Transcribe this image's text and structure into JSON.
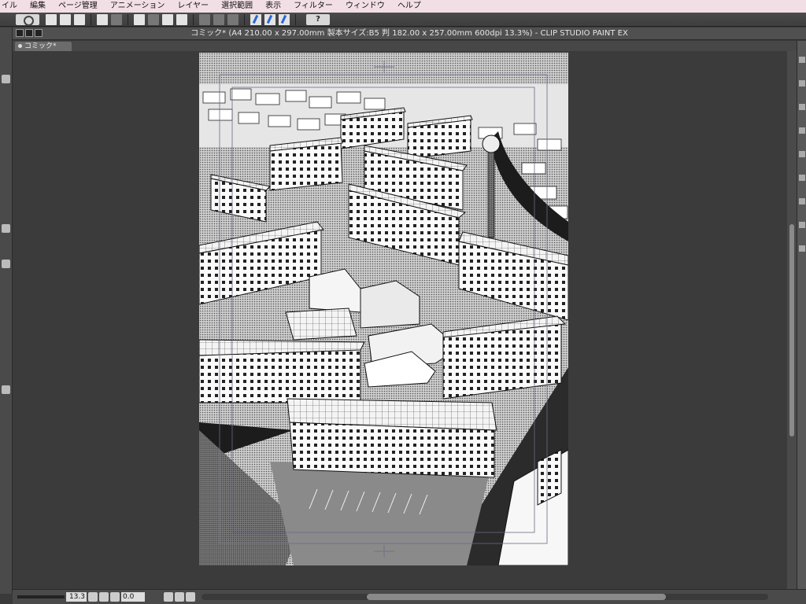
{
  "menu": {
    "items": [
      "イル",
      "編集",
      "ページ管理",
      "アニメーション",
      "レイヤー",
      "選択範囲",
      "表示",
      "フィルター",
      "ウィンドウ",
      "ヘルプ"
    ]
  },
  "toolbar": {
    "logo_icon": "clip-studio-logo-icon",
    "help_label": "?"
  },
  "window": {
    "title": "コミック* (A4 210.00 x 297.00mm 製本サイズ:B5 判 182.00 x 257.00mm 600dpi 13.3%)  - CLIP STUDIO PAINT EX"
  },
  "tabs": [
    {
      "label": "コミック*"
    }
  ],
  "status": {
    "zoom": "13.3",
    "angle": "0.0"
  },
  "colors": {
    "menubar_bg": "#f2dfe6",
    "panel_bg": "#3a3a3a",
    "page_bg": "#ffffff"
  }
}
